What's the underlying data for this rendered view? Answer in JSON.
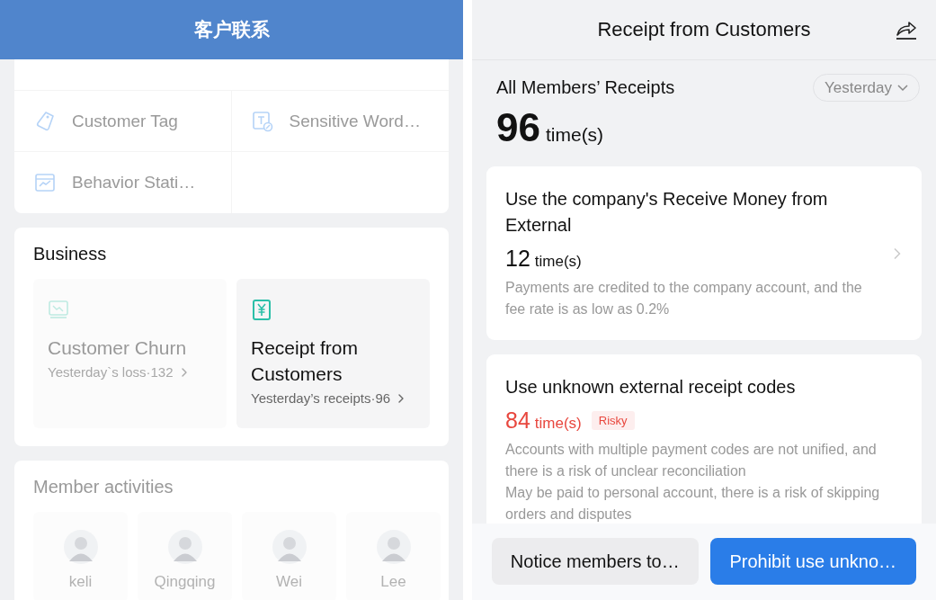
{
  "left_screen": {
    "title": "客户联系",
    "tools": [
      {
        "label": "Customer Tag"
      },
      {
        "label": "Sensitive Word…"
      },
      {
        "label": "Behavior Stati…"
      }
    ],
    "business": {
      "title": "Business",
      "tiles": [
        {
          "title": "Customer Churn",
          "subtitle": "Yesterday`s loss·132",
          "disabled": true
        },
        {
          "title": "Receipt from Customers",
          "subtitle": "Yesterday’s receipts·96",
          "disabled": false
        }
      ]
    },
    "members": {
      "title": "Member activities",
      "people": [
        {
          "name": "keli"
        },
        {
          "name": "Qingqing"
        },
        {
          "name": "Wei"
        },
        {
          "name": "Lee"
        }
      ]
    }
  },
  "right_screen": {
    "title": "Receipt from Customers",
    "summary_label": "All Members’ Receipts",
    "period": "Yesterday",
    "total": "96",
    "unit": "time(s)",
    "methods": [
      {
        "title": "Use the company's Receive Money from External",
        "count": "12",
        "unit": "time(s)",
        "risky": false,
        "chevron": true,
        "description": [
          "Payments are credited to the company account, and the fee rate is as low as 0.2%"
        ]
      },
      {
        "title": "Use unknown external receipt codes",
        "count": "84",
        "unit": "time(s)",
        "risky": true,
        "badge": "Risky",
        "chevron": false,
        "description": [
          "Accounts with multiple payment codes are not unified, and there is a risk of unclear reconciliation",
          "May be paid to personal account, there is a risk of skipping orders and disputes"
        ]
      }
    ],
    "buttons": [
      {
        "label": "Notice members to…",
        "kind": "secondary"
      },
      {
        "label": "Prohibit use unkno…",
        "kind": "primary"
      }
    ]
  }
}
